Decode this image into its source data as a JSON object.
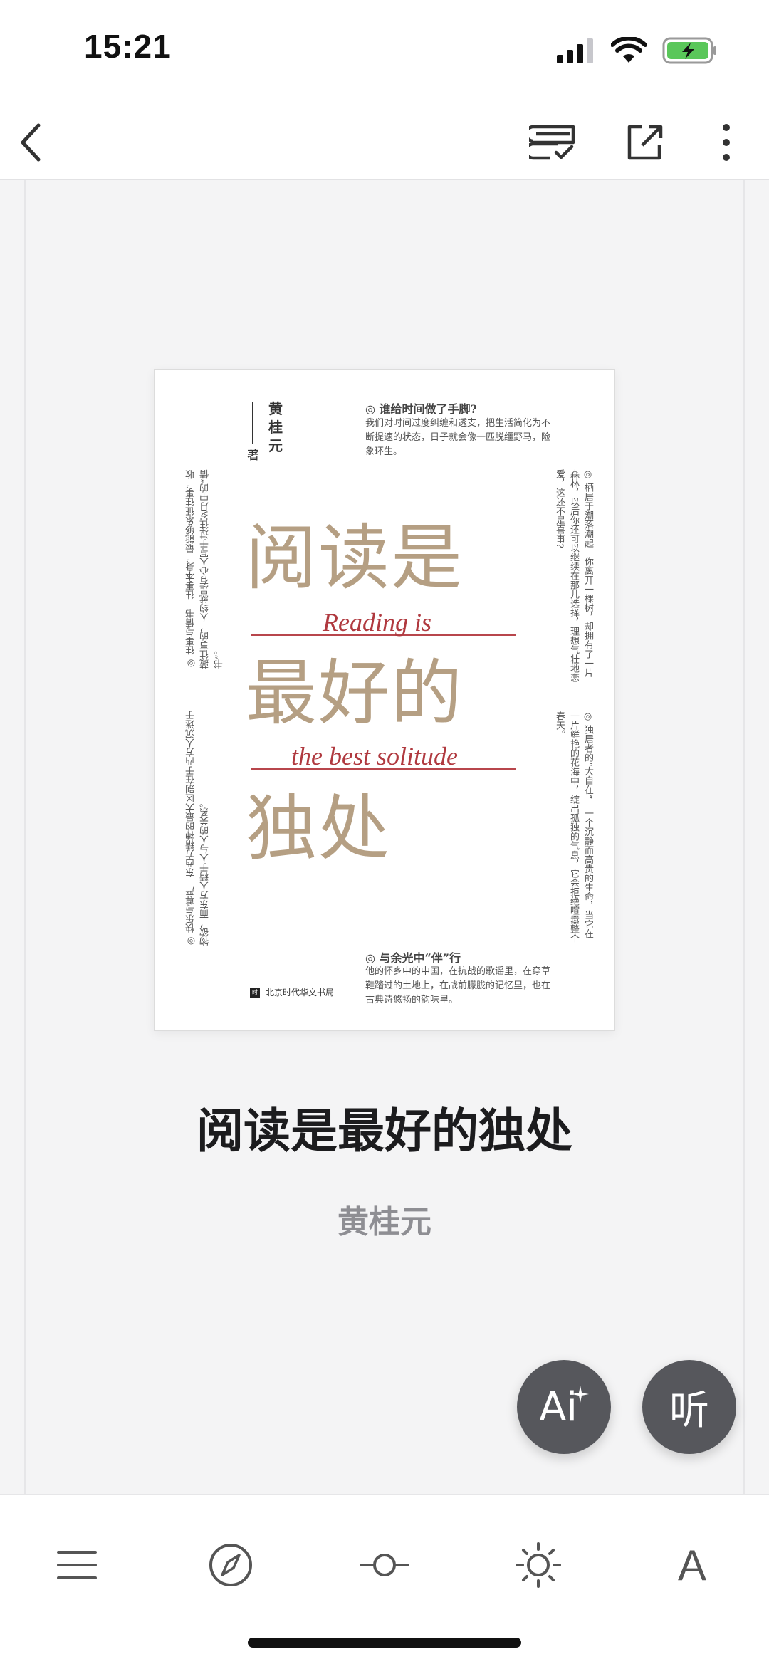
{
  "status_bar": {
    "time": "15:21",
    "battery_color": "#5ac75a"
  },
  "nav": {
    "back_icon": "chevron-left-icon",
    "bookmark_icon": "notes-icon",
    "share_icon": "share-icon",
    "more_icon": "more-vertical-icon"
  },
  "cover": {
    "author": "黄桂元",
    "author_chars": [
      "黄",
      "桂",
      "元"
    ],
    "author_suffix": "著",
    "title_lines": [
      "阅读是",
      "最好的",
      "独处"
    ],
    "english_lines": [
      "Reading is",
      "the best solitude"
    ],
    "section_top_title": "◎ 谁给时间做了手脚?",
    "section_top_text": "我们对时间过度纠缠和透支，把生活简化为不断提速的状态，日子就会像一匹脱缰野马，险象环生。",
    "section_bottom_title": "◎ 与余光中“伴”行",
    "section_bottom_text": "他的怀乡中的中国，在抗战的歌谣里，在穿草鞋踏过的土地上，在战前朦胧的记忆里，也在古典诗悠扬的韵味里。",
    "left_upper": "◎ 往事与情书　往事本身，最能够象征往事，收藏往事的，大约就是有心人写于过往岁月中的“情书”。",
    "left_lower": "◎ 快乐与尊严　东西方精神的最大区别在于西方人沉迷于物欲，而东方人精于人与人的关系。",
    "right_upper": "◎ 栖居于潮落潮起　你离开一棵树，却拥有了一片森林，以后你还可以继续在那儿选择，理想气壮地恋爱，这还不是喜事?",
    "right_lower": "◎ 独居者的“大自在”　一个沉静而高贵的生命，当它在一片鲜艳的花海中，绽出孤独的气息，它会拒绝喧嚣整个春天。",
    "publisher": "北京时代华文书局",
    "publisher_logo": "时"
  },
  "book": {
    "title": "阅读是最好的独处",
    "author": "黄桂元"
  },
  "fabs": {
    "ai_label": "Ai",
    "listen_label": "听"
  },
  "toolbar": {
    "items": [
      "menu-icon",
      "compass-icon",
      "progress-icon",
      "brightness-icon",
      "font-icon"
    ],
    "font_label": "A"
  }
}
